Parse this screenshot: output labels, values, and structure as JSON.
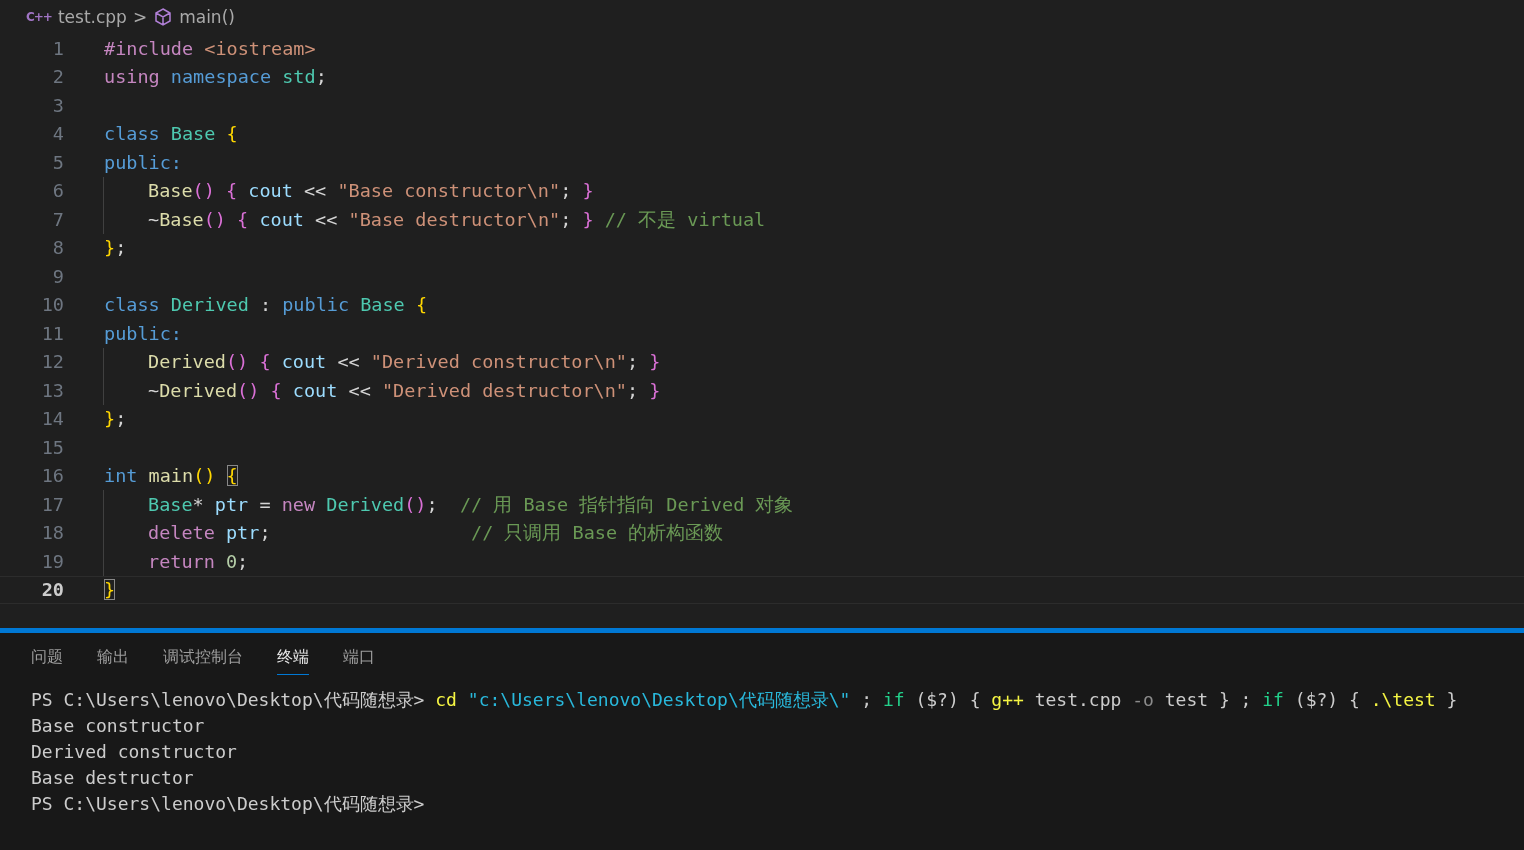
{
  "breadcrumb": {
    "file_icon": "C++",
    "file": "test.cpp",
    "separator": ">",
    "symbol": "main()"
  },
  "editor": {
    "lines": [
      {
        "number": "1",
        "selected": false,
        "indented": false,
        "tokens": [
          {
            "text": "#include ",
            "kind": "keyword"
          },
          {
            "text": "<iostream>",
            "kind": "string"
          }
        ]
      },
      {
        "number": "2",
        "selected": false,
        "indented": false,
        "tokens": [
          {
            "text": "using ",
            "kind": "keyword"
          },
          {
            "text": "namespace ",
            "kind": "storage"
          },
          {
            "text": "std",
            "kind": "type"
          },
          {
            "text": ";",
            "kind": "plain"
          }
        ]
      },
      {
        "number": "3",
        "selected": false,
        "indented": false
      },
      {
        "number": "4",
        "selected": false,
        "indented": false,
        "tokens": [
          {
            "text": "class ",
            "kind": "storage"
          },
          {
            "text": "Base ",
            "kind": "type"
          },
          {
            "text": "{",
            "kind": "bracket1"
          }
        ]
      },
      {
        "number": "5",
        "selected": false,
        "indented": false,
        "tokens": [
          {
            "text": "public:",
            "kind": "storage"
          }
        ]
      },
      {
        "number": "6",
        "selected": false,
        "indented": true,
        "tokens": [
          {
            "text": "Base",
            "kind": "function"
          },
          {
            "text": "() { ",
            "kind": "bracket2"
          },
          {
            "text": "cout ",
            "kind": "variable"
          },
          {
            "text": "<< ",
            "kind": "plain"
          },
          {
            "text": "\"Base constructor\\n\"",
            "kind": "string"
          },
          {
            "text": "; ",
            "kind": "plain"
          },
          {
            "text": "}",
            "kind": "bracket2"
          }
        ]
      },
      {
        "number": "7",
        "selected": false,
        "indented": true,
        "tokens": [
          {
            "text": "~",
            "kind": "plain"
          },
          {
            "text": "Base",
            "kind": "function"
          },
          {
            "text": "() { ",
            "kind": "bracket2"
          },
          {
            "text": "cout ",
            "kind": "variable"
          },
          {
            "text": "<< ",
            "kind": "plain"
          },
          {
            "text": "\"Base destructor\\n\"",
            "kind": "string"
          },
          {
            "text": "; ",
            "kind": "plain"
          },
          {
            "text": "} ",
            "kind": "bracket2"
          },
          {
            "text": "// 不是 virtual",
            "kind": "comment"
          }
        ]
      },
      {
        "number": "8",
        "selected": false,
        "indented": false,
        "tokens": [
          {
            "text": "}",
            "kind": "bracket1"
          },
          {
            "text": ";",
            "kind": "plain"
          }
        ]
      },
      {
        "number": "9",
        "selected": false,
        "indented": false
      },
      {
        "number": "10",
        "selected": false,
        "indented": false,
        "tokens": [
          {
            "text": "class ",
            "kind": "storage"
          },
          {
            "text": "Derived ",
            "kind": "type"
          },
          {
            "text": ": ",
            "kind": "plain"
          },
          {
            "text": "public ",
            "kind": "storage"
          },
          {
            "text": "Base ",
            "kind": "type"
          },
          {
            "text": "{",
            "kind": "bracket1"
          }
        ]
      },
      {
        "number": "11",
        "selected": false,
        "indented": false,
        "tokens": [
          {
            "text": "public:",
            "kind": "storage"
          }
        ]
      },
      {
        "number": "12",
        "selected": false,
        "indented": true,
        "tokens": [
          {
            "text": "Derived",
            "kind": "function"
          },
          {
            "text": "() { ",
            "kind": "bracket2"
          },
          {
            "text": "cout ",
            "kind": "variable"
          },
          {
            "text": "<< ",
            "kind": "plain"
          },
          {
            "text": "\"Derived constructor\\n\"",
            "kind": "string"
          },
          {
            "text": "; ",
            "kind": "plain"
          },
          {
            "text": "}",
            "kind": "bracket2"
          }
        ]
      },
      {
        "number": "13",
        "selected": false,
        "indented": true,
        "tokens": [
          {
            "text": "~",
            "kind": "plain"
          },
          {
            "text": "Derived",
            "kind": "function"
          },
          {
            "text": "() { ",
            "kind": "bracket2"
          },
          {
            "text": "cout ",
            "kind": "variable"
          },
          {
            "text": "<< ",
            "kind": "plain"
          },
          {
            "text": "\"Derived destructor\\n\"",
            "kind": "string"
          },
          {
            "text": "; ",
            "kind": "plain"
          },
          {
            "text": "}",
            "kind": "bracket2"
          }
        ]
      },
      {
        "number": "14",
        "selected": false,
        "indented": false,
        "tokens": [
          {
            "text": "}",
            "kind": "bracket1"
          },
          {
            "text": ";",
            "kind": "plain"
          }
        ]
      },
      {
        "number": "15",
        "selected": false,
        "indented": false
      },
      {
        "number": "16",
        "selected": false,
        "indented": false,
        "tokens": [
          {
            "text": "int ",
            "kind": "storage"
          },
          {
            "text": "main",
            "kind": "function"
          },
          {
            "text": "() ",
            "kind": "bracket1"
          },
          {
            "text": "{",
            "kind": "bracket-match"
          }
        ]
      },
      {
        "number": "17",
        "selected": false,
        "indented": true,
        "tokens": [
          {
            "text": "Base",
            "kind": "type"
          },
          {
            "text": "* ",
            "kind": "plain"
          },
          {
            "text": "ptr ",
            "kind": "variable"
          },
          {
            "text": "= ",
            "kind": "plain"
          },
          {
            "text": "new ",
            "kind": "keyword"
          },
          {
            "text": "Derived",
            "kind": "type"
          },
          {
            "text": "()",
            "kind": "bracket2"
          },
          {
            "text": ";  ",
            "kind": "plain"
          },
          {
            "text": "// 用 Base 指针指向 Derived 对象",
            "kind": "comment"
          }
        ]
      },
      {
        "number": "18",
        "selected": false,
        "indented": true,
        "tokens": [
          {
            "text": "delete ",
            "kind": "keyword"
          },
          {
            "text": "ptr",
            "kind": "variable"
          },
          {
            "text": ";                  ",
            "kind": "plain"
          },
          {
            "text": "// 只调用 Base 的析构函数",
            "kind": "comment"
          }
        ]
      },
      {
        "number": "19",
        "selected": false,
        "indented": true,
        "tokens": [
          {
            "text": "return ",
            "kind": "keyword"
          },
          {
            "text": "0",
            "kind": "number"
          },
          {
            "text": ";",
            "kind": "plain"
          }
        ]
      },
      {
        "number": "20",
        "selected": true,
        "indented": false,
        "tokens": [
          {
            "text": "}",
            "kind": "bracket-match"
          }
        ]
      }
    ]
  },
  "panel": {
    "tabs": [
      {
        "label": "问题",
        "selected": false
      },
      {
        "label": "输出",
        "selected": false
      },
      {
        "label": "调试控制台",
        "selected": false
      },
      {
        "label": "终端",
        "selected": true
      },
      {
        "label": "端口",
        "selected": false
      }
    ],
    "terminal": [
      [
        {
          "text": "PS C:\\Users\\lenovo\\Desktop\\代码随想录> ",
          "kind": "plain"
        },
        {
          "text": "cd ",
          "kind": "command"
        },
        {
          "text": "\"c:\\Users\\lenovo\\Desktop\\代码随想录\\\"",
          "kind": "path"
        },
        {
          "text": " ; ",
          "kind": "plain"
        },
        {
          "text": "if",
          "kind": "control"
        },
        {
          "text": " ($?) { ",
          "kind": "plain"
        },
        {
          "text": "g++",
          "kind": "command"
        },
        {
          "text": " test.cpp ",
          "kind": "plain"
        },
        {
          "text": "-o",
          "kind": "flag"
        },
        {
          "text": " test } ; ",
          "kind": "plain"
        },
        {
          "text": "if",
          "kind": "control"
        },
        {
          "text": " ($?) { ",
          "kind": "plain"
        },
        {
          "text": ".\\test",
          "kind": "command"
        },
        {
          "text": " }",
          "kind": "plain"
        }
      ],
      [
        {
          "text": "Base constructor",
          "kind": "plain"
        }
      ],
      [
        {
          "text": "Derived constructor",
          "kind": "plain"
        }
      ],
      [
        {
          "text": "Base destructor",
          "kind": "plain"
        }
      ],
      [
        {
          "text": "PS C:\\Users\\lenovo\\Desktop\\代码随想录>",
          "kind": "plain"
        }
      ]
    ]
  }
}
